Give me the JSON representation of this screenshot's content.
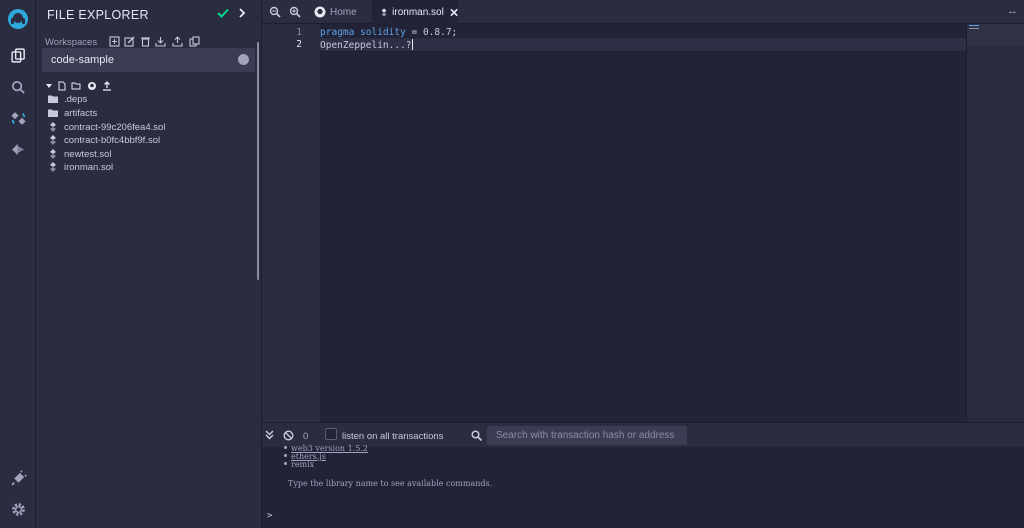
{
  "colors": {
    "accent": "#2ec1f7",
    "success": "#00d88a",
    "background": "#222336",
    "panel": "#2a2c3f",
    "keyword": "#5fa3e8"
  },
  "sidebar": {
    "title": "FILE EXPLORER",
    "workspaces_label": "Workspaces",
    "workspace_selected": "code-sample",
    "files": [
      {
        "name": ".deps",
        "type": "folder"
      },
      {
        "name": "artifacts",
        "type": "folder"
      },
      {
        "name": "contract-99c206fea4.sol",
        "type": "solidity-file"
      },
      {
        "name": "contract-b0fc4bbf9f.sol",
        "type": "solidity-file"
      },
      {
        "name": "newtest.sol",
        "type": "solidity-file"
      },
      {
        "name": "ironman.sol",
        "type": "solidity-file"
      }
    ]
  },
  "tabs": {
    "home_label": "Home",
    "active_label": "ironman.sol"
  },
  "editor": {
    "line_numbers": [
      "1",
      "2"
    ],
    "line1_keyword": "pragma solidity",
    "line1_rest": " = 0.8.7;",
    "line2": "OpenZeppelin...?"
  },
  "terminal": {
    "count": "0",
    "listen_label": "listen on all transactions",
    "search_placeholder": "Search with transaction hash or address",
    "libraries": [
      "web3 version 1.5.2",
      "ethers.js",
      "remix"
    ],
    "hint": "Type the library name to see available commands.",
    "prompt": ">"
  },
  "icons": {
    "rail": [
      "remix-logo-icon",
      "file-explorer-icon",
      "search-icon",
      "solidity-compiler-icon",
      "deploy-run-icon",
      "plugin-manager-icon",
      "settings-icon"
    ]
  }
}
